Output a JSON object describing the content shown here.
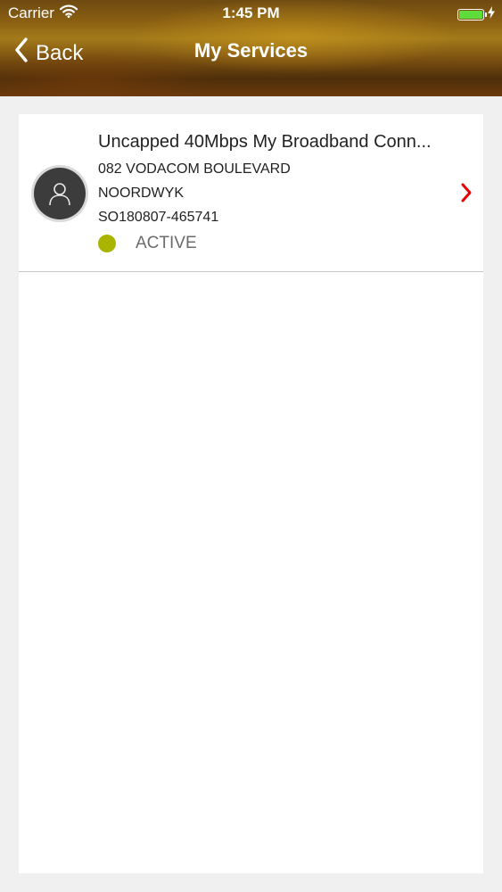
{
  "status_bar": {
    "carrier": "Carrier",
    "time": "1:45 PM",
    "icons": [
      "wifi-icon",
      "battery-icon",
      "charging-bolt-icon"
    ]
  },
  "nav": {
    "back_label": "Back",
    "title": "My Services"
  },
  "services": [
    {
      "title": "Uncapped 40Mbps My Broadband Conn...",
      "address": "082 VODACOM BOULEVARD",
      "city": "NOORDWYK",
      "order_number": "SO180807-465741",
      "status": "ACTIVE",
      "status_color": "#a8b400",
      "icons": [
        "user-avatar-icon",
        "chevron-right-icon"
      ]
    }
  ],
  "colors": {
    "accent": "#e60000",
    "battery": "#5ddc3c",
    "background": "#f0f0f0"
  }
}
